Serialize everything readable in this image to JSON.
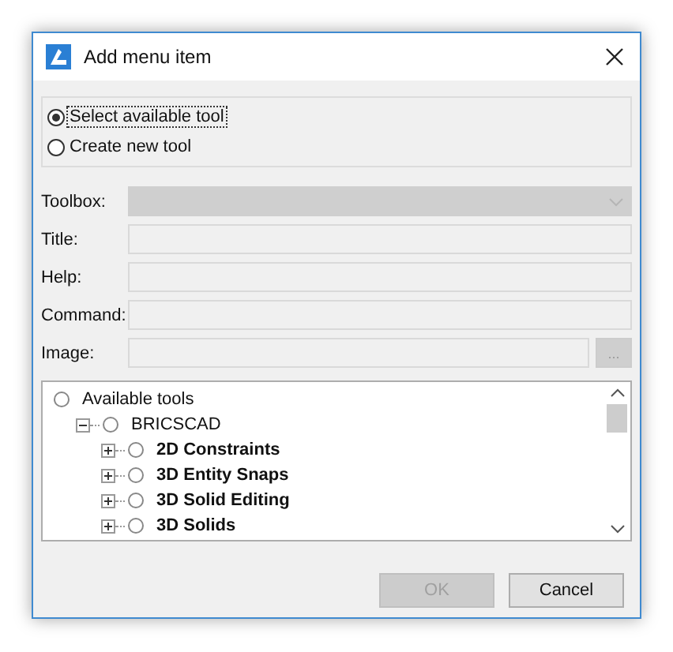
{
  "window": {
    "title": "Add menu item"
  },
  "mode_options": [
    {
      "label": "Select available tool",
      "selected": true
    },
    {
      "label": "Create new tool",
      "selected": false
    }
  ],
  "fields": [
    {
      "label": "Toolbox:",
      "kind": "dropdown",
      "disabled": true
    },
    {
      "label": "Title:",
      "kind": "text",
      "disabled": true
    },
    {
      "label": "Help:",
      "kind": "text",
      "disabled": true
    },
    {
      "label": "Command:",
      "kind": "text",
      "disabled": true
    },
    {
      "label": "Image:",
      "kind": "browse",
      "disabled": true,
      "button": "..."
    }
  ],
  "tree": [
    {
      "label": "Available tools",
      "selected": false,
      "children": [
        {
          "label": "BRICSCAD",
          "selected": false,
          "expanded": true,
          "children": [
            {
              "label": "2D Constraints",
              "selected": false,
              "expanded": false
            },
            {
              "label": "3D Entity Snaps",
              "selected": false,
              "expanded": false
            },
            {
              "label": "3D Solid Editing",
              "selected": false,
              "expanded": false
            },
            {
              "label": "3D Solids",
              "selected": false,
              "expanded": false
            }
          ]
        }
      ]
    }
  ],
  "buttons": [
    {
      "label": "OK",
      "disabled": true
    },
    {
      "label": "Cancel",
      "disabled": false
    }
  ]
}
